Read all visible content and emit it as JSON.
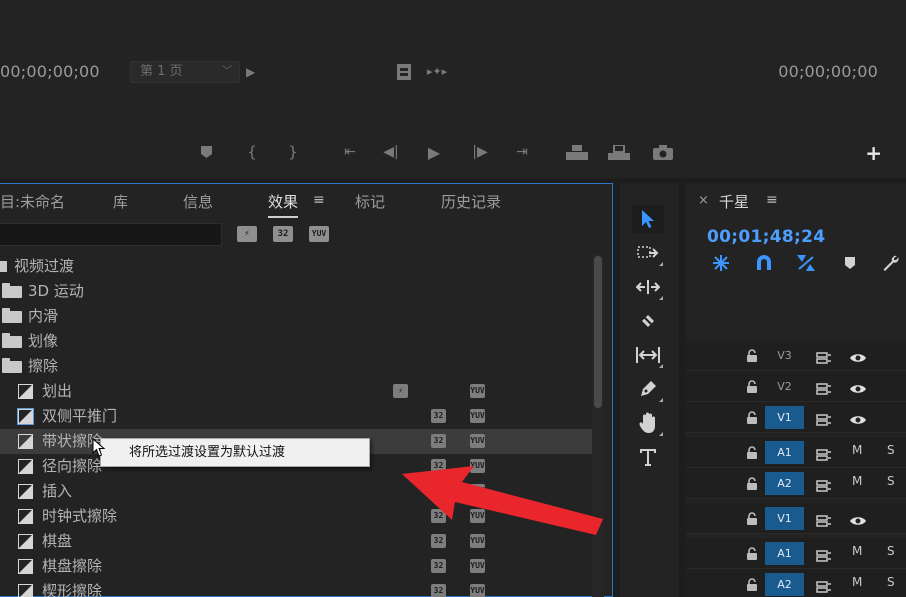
{
  "monitor": {
    "timecode_left": "00;00;00;00",
    "timecode_right": "00;00;00;00",
    "page_select": "第 1 页"
  },
  "effects_panel": {
    "tabs": [
      {
        "label": "目:未命名"
      },
      {
        "label": "库"
      },
      {
        "label": "信息"
      },
      {
        "label": "效果"
      },
      {
        "label": "标记"
      },
      {
        "label": "历史记录"
      }
    ],
    "active_tab": "效果",
    "tab_menu": "≡",
    "search_value": "",
    "badges": {
      "accel": "⚡",
      "b32": "32",
      "yuv": "YUV"
    },
    "tree": {
      "root": "视频过渡",
      "folders": [
        "3D 运动",
        "内滑",
        "划像",
        "擦除"
      ],
      "items": [
        {
          "label": "划出",
          "accel": true,
          "b32": false,
          "yuv": true
        },
        {
          "label": "双侧平推门",
          "b32": true,
          "yuv": true
        },
        {
          "label": "带状擦除",
          "b32": true,
          "yuv": true
        },
        {
          "label": "径向擦除",
          "b32": true,
          "yuv": true
        },
        {
          "label": "插入",
          "b32": true,
          "yuv": true
        },
        {
          "label": "时钟式擦除",
          "b32": true,
          "yuv": true
        },
        {
          "label": "棋盘",
          "b32": true,
          "yuv": true
        },
        {
          "label": "棋盘擦除",
          "b32": true,
          "yuv": true
        },
        {
          "label": "楔形擦除",
          "b32": true,
          "yuv": true
        }
      ]
    },
    "context_menu": "将所选过渡设置为默认过渡"
  },
  "timeline": {
    "close": "×",
    "sequence_name": "千星",
    "menu": "≡",
    "timecode": "00;01;48;24",
    "tracks": [
      {
        "name": "V3",
        "type": "video",
        "on": false
      },
      {
        "name": "V2",
        "type": "video",
        "on": false
      },
      {
        "name": "V1",
        "type": "video",
        "on": true
      },
      {
        "name": "A1",
        "type": "audio",
        "on": true,
        "m": "M",
        "s": "S"
      },
      {
        "name": "A2",
        "type": "audio",
        "on": true,
        "m": "M",
        "s": "S"
      },
      {
        "name": "V1",
        "type": "video",
        "on": true
      },
      {
        "name": "A1",
        "type": "audio",
        "on": true,
        "m": "M",
        "s": "S"
      },
      {
        "name": "A2",
        "type": "audio",
        "on": true,
        "m": "M",
        "s": "S"
      }
    ]
  },
  "colors": {
    "accent_blue": "#3a95ff",
    "track_on": "#1a5b8f",
    "panel_border": "#2d74c5",
    "annotation_arrow": "#e8262b"
  }
}
